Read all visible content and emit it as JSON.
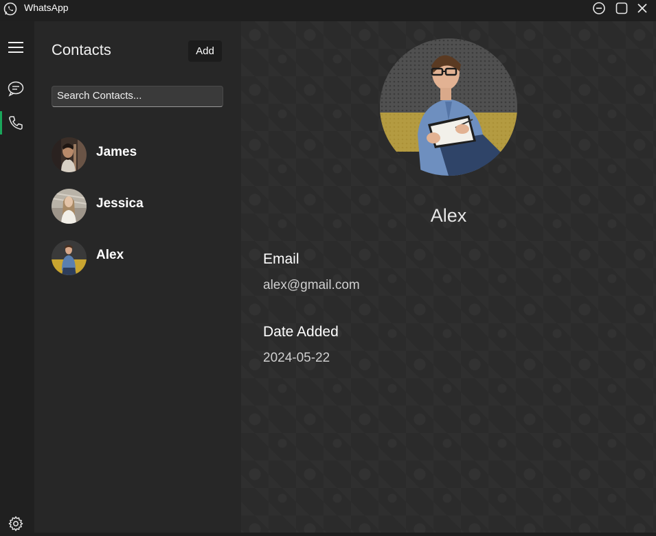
{
  "titlebar": {
    "title": "WhatsApp",
    "icons": [
      "whatsapp-logo-icon",
      "minimize-icon",
      "maximize-icon",
      "close-icon"
    ]
  },
  "rail": {
    "icons": [
      "menu-icon",
      "chat-icon",
      "phone-icon",
      "gear-icon"
    ],
    "accent": "#1aa65b"
  },
  "contacts": {
    "title": "Contacts",
    "add_label": "Add",
    "search_placeholder": "Search Contacts...",
    "items": [
      {
        "name": "James"
      },
      {
        "name": "Jessica"
      },
      {
        "name": "Alex"
      }
    ]
  },
  "detail": {
    "name": "Alex",
    "email_label": "Email",
    "email_value": "alex@gmail.com",
    "date_label": "Date Added",
    "date_value": "2024-05-22"
  }
}
